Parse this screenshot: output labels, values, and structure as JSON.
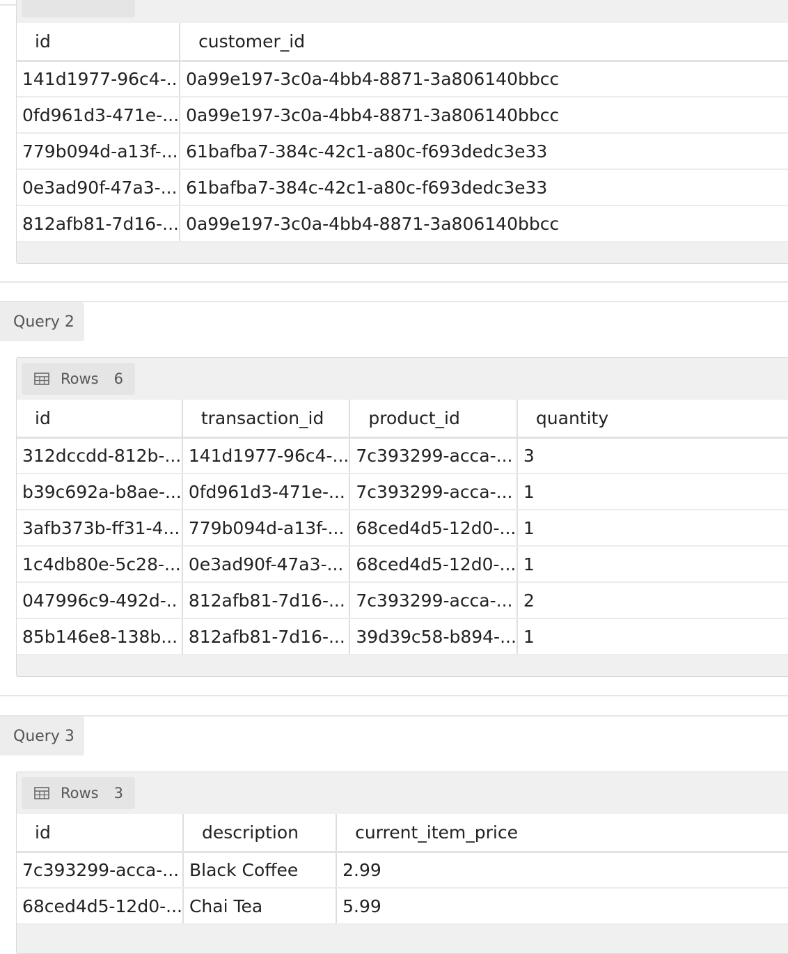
{
  "query1": {
    "columns": [
      "id",
      "customer_id"
    ],
    "rows": [
      [
        "141d1977-96c4-..",
        "0a99e197-3c0a-4bb4-8871-3a806140bbcc"
      ],
      [
        "0fd961d3-471e-...",
        "0a99e197-3c0a-4bb4-8871-3a806140bbcc"
      ],
      [
        "779b094d-a13f-...",
        "61bafba7-384c-42c1-a80c-f693dedc3e33"
      ],
      [
        "0e3ad90f-47a3-...",
        "61bafba7-384c-42c1-a80c-f693dedc3e33"
      ],
      [
        "812afb81-7d16-...",
        "0a99e197-3c0a-4bb4-8871-3a806140bbcc"
      ]
    ]
  },
  "query2": {
    "tab_label": "Query 2",
    "rows_label": "Rows",
    "rows_count": "6",
    "columns": [
      "id",
      "transaction_id",
      "product_id",
      "quantity"
    ],
    "rows": [
      [
        "312dccdd-812b-...",
        "141d1977-96c4-...",
        "7c393299-acca-...",
        "3"
      ],
      [
        "b39c692a-b8ae-...",
        "0fd961d3-471e-...",
        "7c393299-acca-...",
        "1"
      ],
      [
        "3afb373b-ff31-4...",
        "779b094d-a13f-...",
        "68ced4d5-12d0-...",
        "1"
      ],
      [
        "1c4db80e-5c28-...",
        "0e3ad90f-47a3-...",
        "68ced4d5-12d0-...",
        "1"
      ],
      [
        "047996c9-492d-..",
        "812afb81-7d16-...",
        "7c393299-acca-...",
        "2"
      ],
      [
        "85b146e8-138b...",
        "812afb81-7d16-...",
        "39d39c58-b894-...",
        "1"
      ]
    ]
  },
  "query3": {
    "tab_label": "Query 3",
    "rows_label": "Rows",
    "rows_count": "3",
    "columns": [
      "id",
      "description",
      "current_item_price"
    ],
    "rows": [
      [
        "7c393299-acca-...",
        "Black Coffee",
        "2.99"
      ],
      [
        "68ced4d5-12d0-...",
        "Chai Tea",
        "5.99"
      ]
    ]
  },
  "icons": {
    "rows": "table-grid-icon"
  },
  "colors": {
    "card_bg": "#f0f0f0",
    "chip_bg": "#e5e5e5",
    "tab_bg": "#ededed",
    "border": "#d9d9d9"
  }
}
